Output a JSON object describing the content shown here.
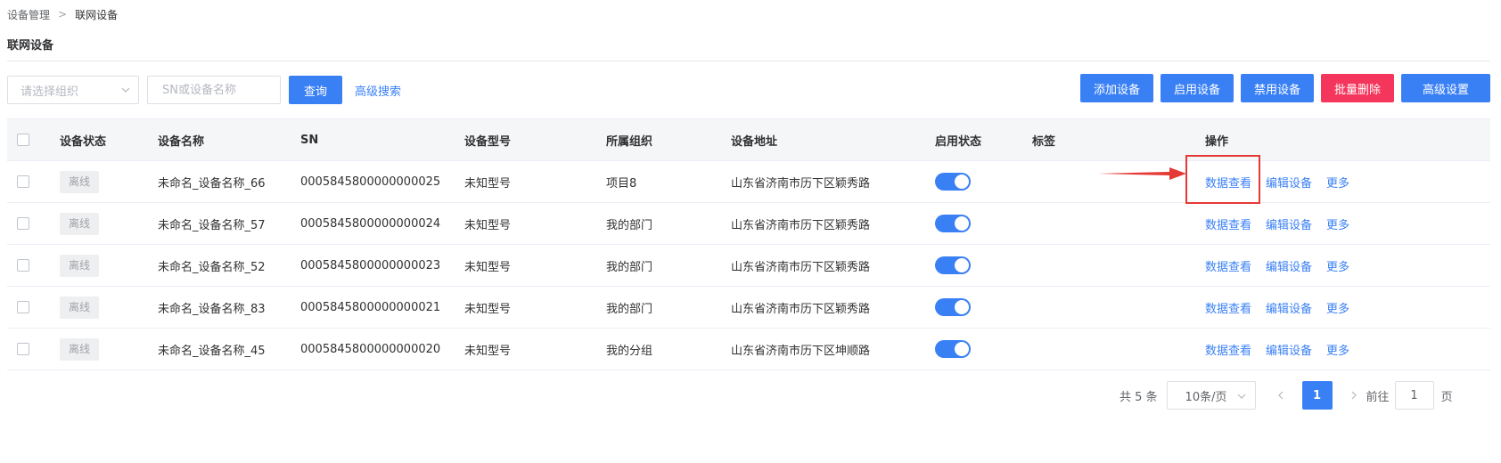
{
  "breadcrumb": {
    "parent": "设备管理",
    "current": "联网设备"
  },
  "page": {
    "title": "联网设备"
  },
  "filters": {
    "org_placeholder": "请选择组织",
    "search_placeholder": "SN或设备名称",
    "query_label": "查询",
    "advanced_search_label": "高级搜索"
  },
  "actions": {
    "add_label": "添加设备",
    "enable_label": "启用设备",
    "disable_label": "禁用设备",
    "batch_delete_label": "批量删除",
    "advanced_settings_label": "高级设置"
  },
  "table": {
    "columns": {
      "status": "设备状态",
      "name": "设备名称",
      "sn": "SN",
      "model": "设备型号",
      "org": "所属组织",
      "address": "设备地址",
      "enabled": "启用状态",
      "tags": "标签",
      "operations": "操作"
    },
    "rows": [
      {
        "status": "离线",
        "name": "未命名_设备名称_66",
        "sn": "0005845800000000025",
        "model": "未知型号",
        "org": "项目8",
        "address": "山东省济南市历下区颖秀路",
        "enabled": true,
        "tags": "",
        "op_view": "数据查看",
        "op_edit": "编辑设备",
        "op_more": "更多"
      },
      {
        "status": "离线",
        "name": "未命名_设备名称_57",
        "sn": "0005845800000000024",
        "model": "未知型号",
        "org": "我的部门",
        "address": "山东省济南市历下区颖秀路",
        "enabled": true,
        "tags": "",
        "op_view": "数据查看",
        "op_edit": "编辑设备",
        "op_more": "更多"
      },
      {
        "status": "离线",
        "name": "未命名_设备名称_52",
        "sn": "0005845800000000023",
        "model": "未知型号",
        "org": "我的部门",
        "address": "山东省济南市历下区颖秀路",
        "enabled": true,
        "tags": "",
        "op_view": "数据查看",
        "op_edit": "编辑设备",
        "op_more": "更多"
      },
      {
        "status": "离线",
        "name": "未命名_设备名称_83",
        "sn": "0005845800000000021",
        "model": "未知型号",
        "org": "我的部门",
        "address": "山东省济南市历下区颖秀路",
        "enabled": true,
        "tags": "",
        "op_view": "数据查看",
        "op_edit": "编辑设备",
        "op_more": "更多"
      },
      {
        "status": "离线",
        "name": "未命名_设备名称_45",
        "sn": "0005845800000000020",
        "model": "未知型号",
        "org": "我的分组",
        "address": "山东省济南市历下区坤顺路",
        "enabled": true,
        "tags": "",
        "op_view": "数据查看",
        "op_edit": "编辑设备",
        "op_more": "更多"
      }
    ]
  },
  "pagination": {
    "total_text": "共 5 条",
    "page_size": "10条/页",
    "current_page": "1",
    "goto_label": "前往",
    "goto_value": "1",
    "page_suffix": "页"
  },
  "colors": {
    "primary": "#3a80f5",
    "danger": "#f5365c",
    "annotation": "#e53935"
  }
}
